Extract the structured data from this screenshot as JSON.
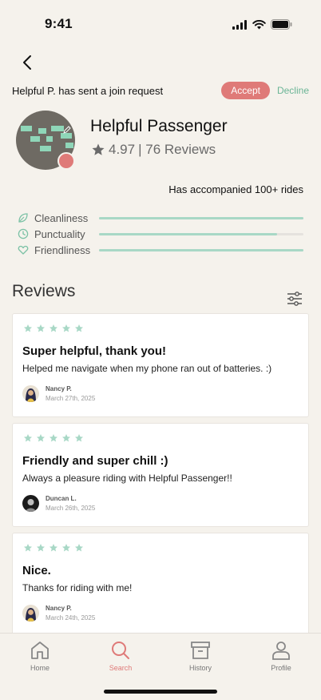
{
  "status_bar": {
    "time": "9:41"
  },
  "request": {
    "text": "Helpful P. has sent a join request",
    "accept_label": "Accept",
    "decline_label": "Decline"
  },
  "profile": {
    "name": "Helpful Passenger",
    "rating": "4.97",
    "reviews_count_text": "| 76 Reviews",
    "accompanied": "Has accompanied 100+ rides"
  },
  "traits": [
    {
      "label": "Cleanliness",
      "icon": "leaf-icon",
      "level": 1.0
    },
    {
      "label": "Punctuality",
      "icon": "clock-icon",
      "level": 0.87
    },
    {
      "label": "Friendliness",
      "icon": "heart-icon",
      "level": 1.0
    }
  ],
  "reviews_section": {
    "title": "Reviews"
  },
  "reviews": [
    {
      "stars": 5,
      "title": "Super helpful, thank you!",
      "body": "Helped me navigate when my phone ran out of batteries. :)",
      "reviewer": "Nancy P.",
      "date": "March 27th, 2025"
    },
    {
      "stars": 5,
      "title": "Friendly and  super chill :)",
      "body": "Always a pleasure riding with Helpful Passenger!!",
      "reviewer": "Duncan L.",
      "date": "March 26th, 2025"
    },
    {
      "stars": 5,
      "title": "Nice.",
      "body": "Thanks for riding with me!",
      "reviewer": "Nancy P.",
      "date": "March 24th, 2025"
    }
  ],
  "tabs": [
    {
      "label": "Home",
      "icon": "home-icon"
    },
    {
      "label": "Search",
      "icon": "search-icon"
    },
    {
      "label": "History",
      "icon": "archive-icon"
    },
    {
      "label": "Profile",
      "icon": "user-icon"
    }
  ],
  "colors": {
    "accent": "#df7a78",
    "mint": "#a8d8c6",
    "background": "#f5f2ec"
  }
}
